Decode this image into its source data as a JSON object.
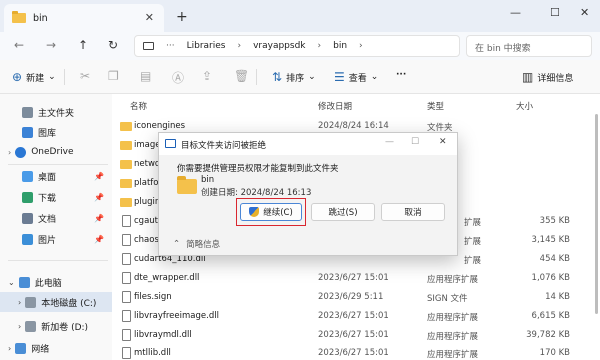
{
  "tab": {
    "title": "bin",
    "close": "✕",
    "new": "+"
  },
  "window": {
    "min": "—",
    "max": "☐",
    "close": "✕"
  },
  "nav": {
    "back": "←",
    "forward": "→",
    "up": "↑",
    "refresh": "↻"
  },
  "address": {
    "more": "···",
    "crumbs": [
      "Libraries",
      "vrayappsdk",
      "bin"
    ]
  },
  "search": {
    "placeholder": "在 bin 中搜索"
  },
  "cmdbar": {
    "new_label": "新建",
    "sort_label": "排序",
    "view_label": "查看",
    "more": "···",
    "details_label": "详细信息"
  },
  "sidebar": {
    "home": "主文件夹",
    "gallery": "图库",
    "onedrive": "OneDrive",
    "desktop": "桌面",
    "downloads": "下载",
    "documents": "文档",
    "pictures": "图片",
    "thispc": "此电脑",
    "local_disk": "本地磁盘 (C:)",
    "new_volume": "新加卷 (D:)",
    "network": "网络"
  },
  "columns": {
    "name": "名称",
    "date": "修改日期",
    "type": "类型",
    "size": "大小"
  },
  "files": [
    {
      "name": "iconengines",
      "date": "2024/8/24 16:14",
      "type": "文件夹",
      "size": "",
      "kind": "folder"
    },
    {
      "name": "imageformats",
      "date": "",
      "type": "",
      "size": "",
      "kind": "folder"
    },
    {
      "name": "networkinformation",
      "date": "",
      "type": "",
      "size": "",
      "kind": "folder"
    },
    {
      "name": "platforms",
      "date": "",
      "type": "",
      "size": "",
      "kind": "folder"
    },
    {
      "name": "plugins",
      "date": "",
      "type": "",
      "size": "",
      "kind": "folder"
    },
    {
      "name": "cgauth.dll",
      "date": "",
      "type": "扩展",
      "size": "355 KB",
      "kind": "file"
    },
    {
      "name": "chaos_license.dll",
      "date": "",
      "type": "扩展",
      "size": "3,145 KB",
      "kind": "file"
    },
    {
      "name": "cudart64_110.dll",
      "date": "",
      "type": "扩展",
      "size": "454 KB",
      "kind": "file"
    },
    {
      "name": "dte_wrapper.dll",
      "date": "2023/6/27 15:01",
      "type": "应用程序扩展",
      "size": "1,076 KB",
      "kind": "file"
    },
    {
      "name": "files.sign",
      "date": "2023/6/29 5:11",
      "type": "SIGN 文件",
      "size": "14 KB",
      "kind": "file"
    },
    {
      "name": "libvrayfreeimage.dll",
      "date": "2023/6/27 15:01",
      "type": "应用程序扩展",
      "size": "6,615 KB",
      "kind": "file"
    },
    {
      "name": "libvraymdl.dll",
      "date": "2023/6/27 15:01",
      "type": "应用程序扩展",
      "size": "39,782 KB",
      "kind": "file"
    },
    {
      "name": "mtllib.dll",
      "date": "2023/6/27 15:01",
      "type": "应用程序扩展",
      "size": "170 KB",
      "kind": "file"
    }
  ],
  "dialog": {
    "title": "目标文件夹访问被拒绝",
    "message": "你需要提供管理员权限才能复制到此文件夹",
    "folder_name": "bin",
    "folder_date": "创建日期: 2024/8/24 16:13",
    "continue_label": "继续(C)",
    "skip_label": "跳过(S)",
    "cancel_label": "取消",
    "details_label": "简略信息"
  }
}
